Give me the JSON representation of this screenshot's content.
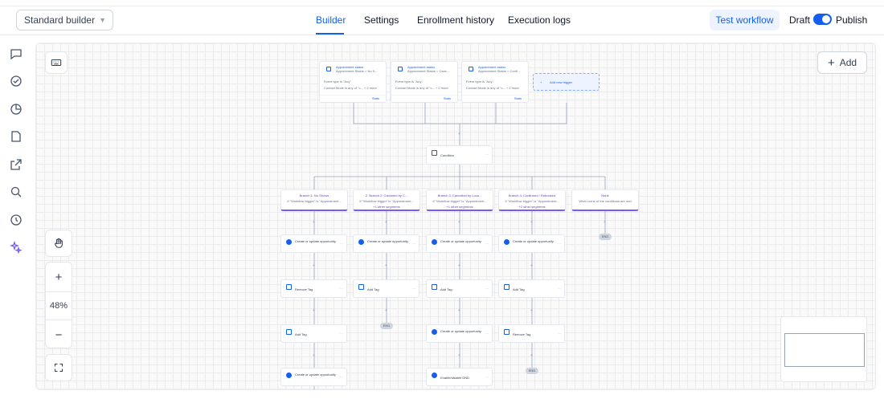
{
  "header": {
    "builder_select": "Standard builder",
    "tabs": [
      "Builder",
      "Settings",
      "Enrollment history",
      "Execution logs"
    ],
    "test_workflow": "Test workflow",
    "draft": "Draft",
    "publish": "Publish"
  },
  "canvas": {
    "add_label": "Add",
    "zoom": "48%",
    "triggers": [
      {
        "title": "Appointment status",
        "subtitle": "Appointment Status = No S...",
        "row1": "Event type is \"Any\"",
        "row2": "Contact Mode is any of \"c...  + 2 more",
        "stats": "Stats"
      },
      {
        "title": "Appointment status",
        "subtitle": "Appointment Status = Canc...",
        "row1": "Event type is \"Any\"",
        "row2": "Contact Mode is any of \"c...  + 2 more",
        "stats": "Stats"
      },
      {
        "title": "Appointment status",
        "subtitle": "Appointment Status = Confi...",
        "row1": "Event type is \"Any\"",
        "row2": "Contact Mode is any of \"c...  + 2 more",
        "stats": "Stats"
      }
    ],
    "add_trigger": "Add new trigger",
    "condition": "Condition",
    "branches": [
      {
        "title": "Branch 1: No Shows",
        "sub": "If \"Workflow trigger\" is \"Appointment...",
        "more": ""
      },
      {
        "title": "2. Branch 2: Canceled by C...",
        "sub": "If \"Workflow trigger\" is \"Appointment...",
        "more": "+1 other segments"
      },
      {
        "title": "Branch 3: Cancelled by Loca...",
        "sub": "If \"Workflow trigger\" is \"Appointment...",
        "more": "+1 other segments"
      },
      {
        "title": "Branch 4: Confirmed / Rebooked",
        "sub": "If \"Workflow trigger\" is \"Appointment...",
        "more": "+2 other segments"
      },
      {
        "title": "None",
        "sub": "When none of the conditions are met",
        "more": ""
      }
    ],
    "actions": {
      "create_opp": "Create or update opportunity",
      "remove_tag": "Remove Tag",
      "add_tag": "Add Tag",
      "enable_dnd": "Enable/disable DND"
    },
    "end": "END"
  }
}
